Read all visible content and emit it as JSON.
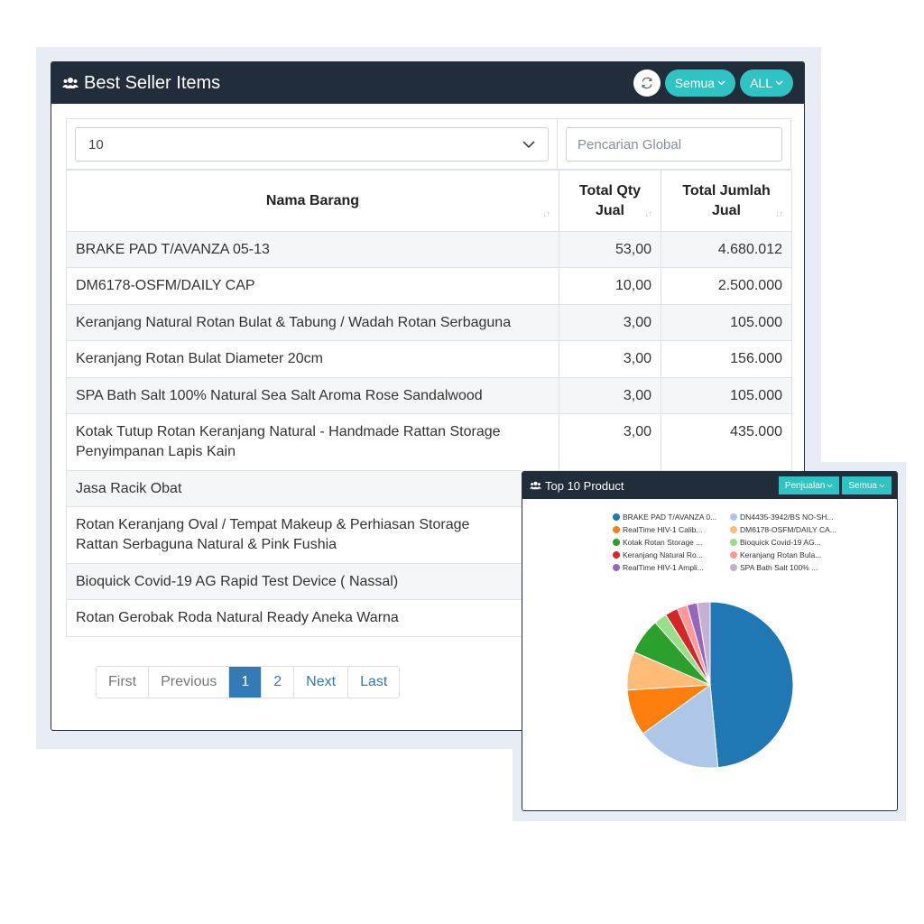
{
  "best_seller": {
    "title": "Best Seller Items",
    "filter_period": "Semua",
    "filter_scope": "ALL",
    "page_length": "10",
    "search_placeholder": "Pencarian Global",
    "columns": {
      "name": "Nama Barang",
      "qty_line1": "Total Qty",
      "qty_line2": "Jual",
      "amount_line1": "Total Jumlah",
      "amount_line2": "Jual"
    },
    "rows": [
      {
        "name": "BRAKE PAD T/AVANZA 05-13",
        "name2": "",
        "qty": "53,00",
        "amount": "4.680.012"
      },
      {
        "name": "DM6178-OSFM/DAILY CAP",
        "name2": "",
        "qty": "10,00",
        "amount": "2.500.000"
      },
      {
        "name": "Keranjang Natural Rotan Bulat & Tabung / Wadah Rotan Serbaguna",
        "name2": "",
        "qty": "3,00",
        "amount": "105.000"
      },
      {
        "name": "Keranjang Rotan Bulat Diameter 20cm",
        "name2": "",
        "qty": "3,00",
        "amount": "156.000"
      },
      {
        "name": "SPA Bath Salt 100% Natural Sea Salt Aroma Rose Sandalwood",
        "name2": "",
        "qty": "3,00",
        "amount": "105.000"
      },
      {
        "name": "Kotak Tutup Rotan Keranjang Natural - Handmade Rattan Storage",
        "name2": "Penyimpanan Lapis Kain",
        "qty": "3,00",
        "amount": "435.000"
      },
      {
        "name": "Jasa Racik Obat",
        "name2": "",
        "qty": "",
        "amount": ""
      },
      {
        "name": "Rotan Keranjang Oval / Tempat Makeup & Perhiasan Storage",
        "name2": "Rattan Serbaguna Natural & Pink Fushia",
        "qty": "",
        "amount": ""
      },
      {
        "name": "Bioquick Covid-19 AG Rapid Test Device ( Nassal)",
        "name2": "",
        "qty": "",
        "amount": ""
      },
      {
        "name": "Rotan Gerobak Roda Natural Ready Aneka Warna",
        "name2": "",
        "qty": "",
        "amount": ""
      }
    ],
    "pagination": {
      "first": "First",
      "previous": "Previous",
      "page1": "1",
      "page2": "2",
      "next": "Next",
      "last": "Last"
    }
  },
  "top_product": {
    "title": "Top 10 Product",
    "filter_metric": "Penjualan",
    "filter_period": "Semua",
    "chart_data": {
      "type": "pie",
      "legend_position": "top",
      "slices": [
        {
          "label": "BRAKE PAD T/AVANZA 0...",
          "value": 48.5,
          "color": "#1f77b4"
        },
        {
          "label": "DN4435-3942/BS NO-SH...",
          "value": 16.5,
          "color": "#aec7e8"
        },
        {
          "label": "RealTime HIV-1 Calib...",
          "value": 9.0,
          "color": "#ff7f0e"
        },
        {
          "label": "DM6178-OSFM/DAILY CA...",
          "value": 7.5,
          "color": "#ffbb78"
        },
        {
          "label": "Kotak Rotan Storage ...",
          "value": 7.0,
          "color": "#2ca02c"
        },
        {
          "label": "Bioquick Covid-19 AG...",
          "value": 2.5,
          "color": "#98df8a"
        },
        {
          "label": "Keranjang Natural Ro...",
          "value": 2.5,
          "color": "#d62728"
        },
        {
          "label": "Keranjang Rotan Bula...",
          "value": 2.0,
          "color": "#ff9896"
        },
        {
          "label": "RealTime HIV-1 Ampli...",
          "value": 2.0,
          "color": "#9467bd"
        },
        {
          "label": "SPA Bath Salt 100% ...",
          "value": 2.5,
          "color": "#c5b0d5"
        }
      ]
    }
  },
  "icons": {
    "users": "users-icon",
    "refresh": "refresh-icon",
    "chevron": "chevron-down-icon"
  }
}
